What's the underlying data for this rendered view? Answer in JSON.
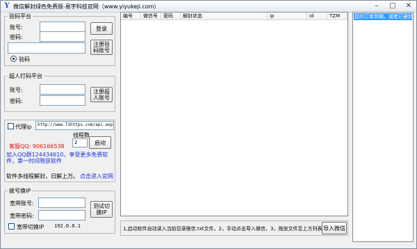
{
  "window": {
    "title": "微信解封绿色免费版-易宇科技官网（www.yiyukeji.com）"
  },
  "titlebar_buttons": {
    "min": "–",
    "max": "□",
    "close": "✕"
  },
  "captcha_group": {
    "title": "验码平台",
    "account_label": "账号:",
    "password_label": "密码:",
    "login_button": "登录",
    "register_button": "注册验码账号",
    "radio_label": "验码"
  },
  "super_group": {
    "title": "超人打码平台",
    "account_label": "账号:",
    "password_label": "密码:",
    "register_button": "注册超人账号"
  },
  "proxy": {
    "checkbox_label": "代理ip",
    "url_value": "http://www.71https.com/api.asp?l",
    "threads_label": "线程数",
    "threads_value": "2",
    "start_button": "启动",
    "qq_text": "客服QQ: 906166538",
    "group_text": "加入QQ群124434610，享受更多免费软件，第一时间限获软件",
    "speed_text": "软件多线程解封，日解上万。",
    "site_link": "点击进入官网"
  },
  "dial_group": {
    "title": "拨号换IP",
    "account_label": "宽带账号:",
    "password_label": "宽带密码:",
    "test_button": "测试切换IP",
    "checkbox_label": "宽带切换IP",
    "ip_value": "192.0.0.1"
  },
  "grid": {
    "columns": [
      "编号",
      "微信号",
      "密码",
      "解封状态",
      "ip",
      "id",
      "TZM"
    ]
  },
  "bottom": {
    "instructions": "1,启动软件自动读入当前目录微信.txt文件，2，手动点击导入微信，3，拖放文件至上方列表",
    "import_button": "导入微信"
  },
  "right_panel": {
    "selected_text": "您的订单到期，或者已被封"
  }
}
